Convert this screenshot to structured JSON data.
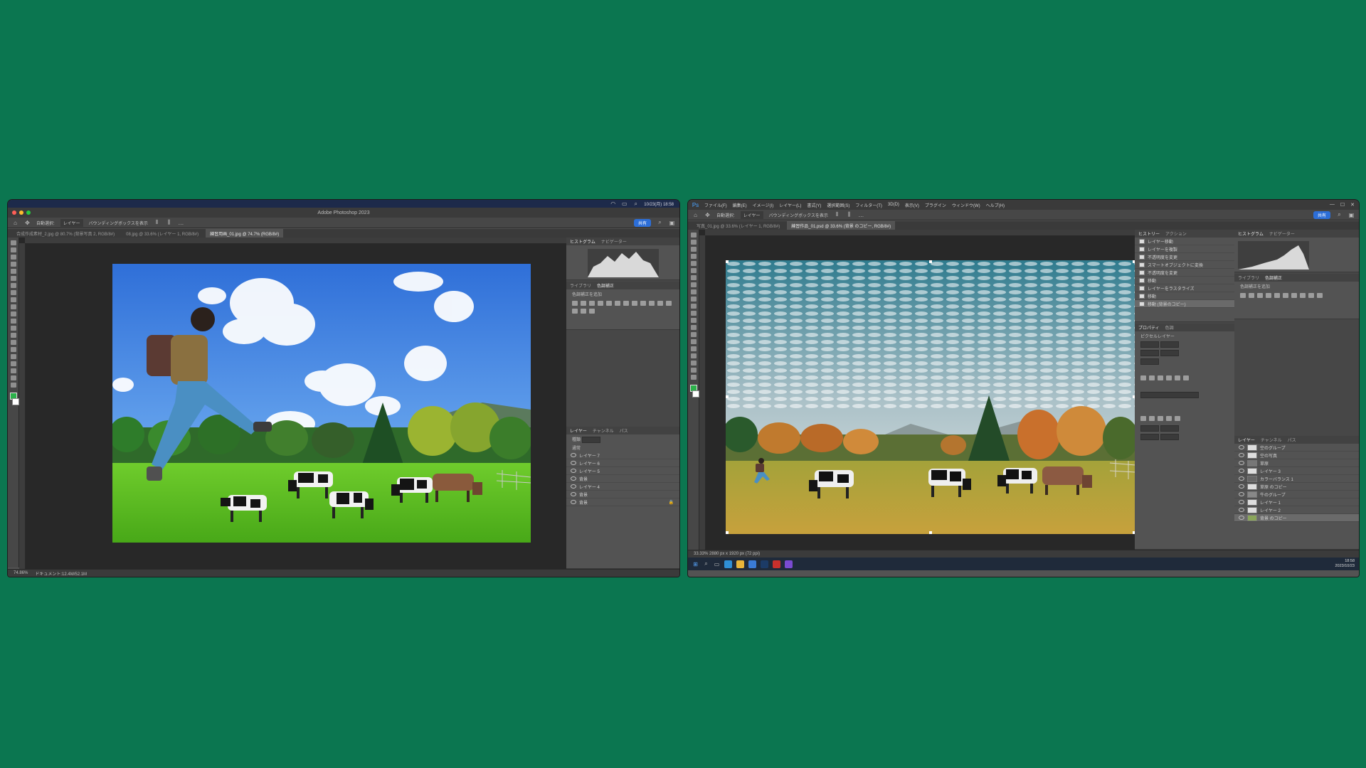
{
  "mac_window": {
    "app_title": "Adobe Photoshop 2023",
    "menubar_time": "10/23(月) 18:58",
    "options_bar": [
      "自動選択:",
      "レイヤー",
      "バウンディングボックスを表示"
    ],
    "share_label": "共有",
    "tabs": [
      "合成作成素材_2.jpg @ 80.7% (背景写真 2, RGB/8#)",
      "08.jpg @ 33.6% (レイヤー 1, RGB/8#)",
      "練習用画_01.jpg @ 74.7% (RGB/8#)"
    ],
    "active_tab": 2,
    "status_zoom": "74.86%",
    "status_info": "ドキュメント:12.4M/52.1M",
    "panel_tabs_top": [
      "ヒストグラム",
      "ナビゲーター"
    ],
    "panel_tabs_adjust": [
      "ライブラリ",
      "色調補正"
    ],
    "adjust_title": "色調補正を追加",
    "panel_tabs_layers": [
      "レイヤー",
      "チャンネル",
      "パス"
    ],
    "layers_filter": "種類",
    "layers_mode": "通常",
    "layers": [
      "レイヤー 7",
      "レイヤー 6",
      "レイヤー 5",
      "背景",
      "レイヤー 4",
      "背景",
      "背景"
    ]
  },
  "win_window": {
    "menus": [
      "ファイル(F)",
      "編集(E)",
      "イメージ(I)",
      "レイヤー(L)",
      "書式(Y)",
      "選択範囲(S)",
      "フィルター(T)",
      "3D(D)",
      "表示(V)",
      "プラグイン",
      "ウィンドウ(W)",
      "ヘルプ(H)"
    ],
    "options_bar": [
      "自動選択:",
      "レイヤー",
      "バウンディングボックスを表示"
    ],
    "share_label": "共有",
    "tabs": [
      "写真_01.jpg @ 33.6% (レイヤー 1, RGB/8#)",
      "練習作品_01.psd @ 33.6% (背景 のコピー, RGB/8#)"
    ],
    "active_tab": 1,
    "status": "33.33%    2880 px x 1920 px (72 ppi)",
    "panel_tabs_history": [
      "ヒストリー",
      "アクション"
    ],
    "history": [
      "レイヤー移動",
      "レイヤーを複製",
      "不透明度を変更",
      "スマートオブジェクトに変換",
      "不透明度を変更",
      "移動",
      "レイヤーをラスタライズ",
      "移動",
      "移動 (背景のコピー)"
    ],
    "panel_tabs_props": [
      "プロパティ",
      "色調"
    ],
    "props_title": "ピクセルレイヤー",
    "panel_tabs_hist": [
      "ヒストグラム",
      "ナビゲーター"
    ],
    "panel_tabs_adjust": [
      "ライブラリ",
      "色調補正"
    ],
    "adjust_title": "色調補正を追加",
    "panel_tabs_layers": [
      "レイヤー",
      "チャンネル",
      "パス"
    ],
    "layers": [
      "空のグループ",
      "空の写真",
      "草原",
      "レイヤー 3",
      "カラーバランス 1",
      "草原 のコピー",
      "牛のグループ",
      "レイヤー 1",
      "レイヤー 2",
      "背景 のコピー"
    ],
    "clock_time": "18:58",
    "clock_date": "2023/10/23"
  },
  "colors": {
    "background": "#0b7650",
    "ui_dark": "#535353",
    "accent": "#2c6ed8"
  }
}
